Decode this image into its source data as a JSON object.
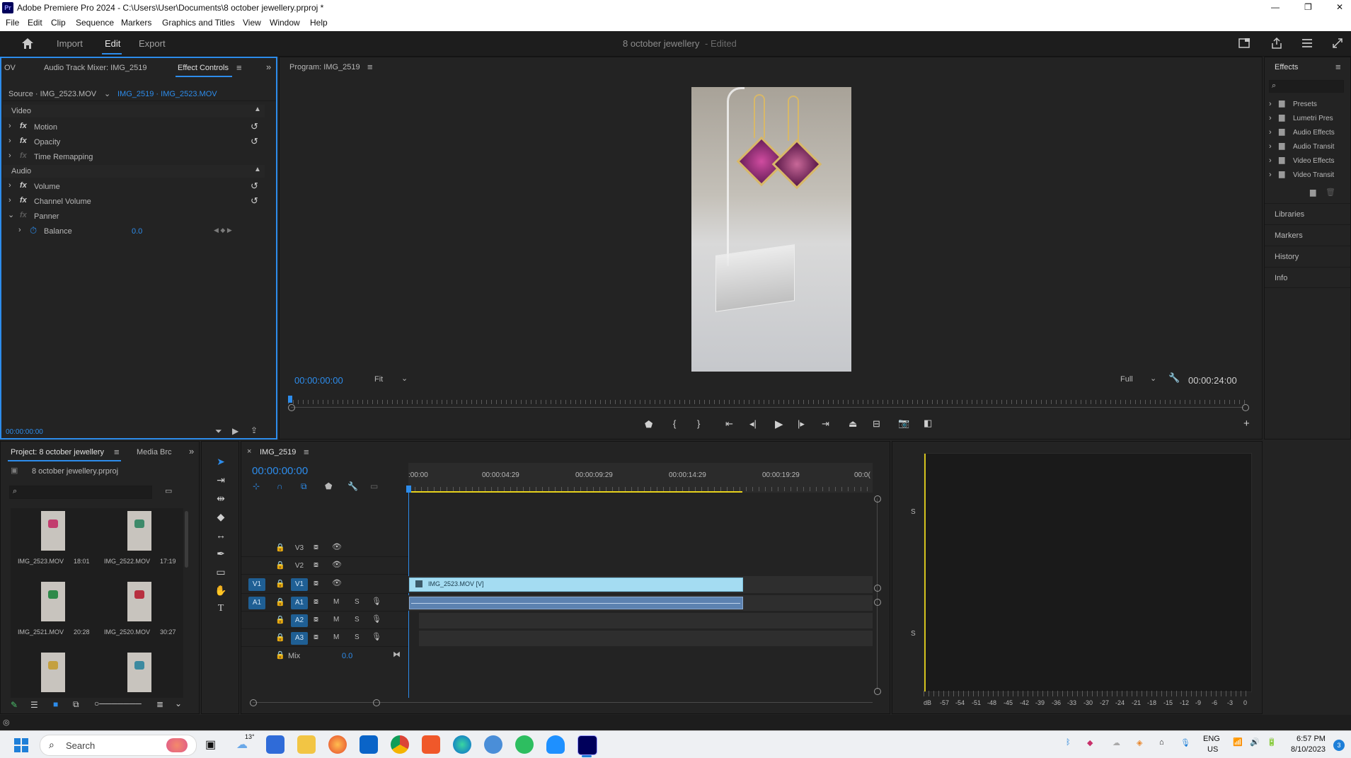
{
  "window": {
    "app_badge": "Pr",
    "title": "Adobe Premiere Pro 2024 - C:\\Users\\User\\Documents\\8 october jewellery.prproj *",
    "min": "—",
    "max": "❐",
    "close": "✕"
  },
  "menu": [
    "File",
    "Edit",
    "Clip",
    "Sequence",
    "Markers",
    "Graphics and Titles",
    "View",
    "Window",
    "Help"
  ],
  "workspace": {
    "tabs": [
      "Import",
      "Edit",
      "Export"
    ],
    "active": "Edit",
    "project_name": "8 october jewellery",
    "status": "- Edited"
  },
  "effect_controls": {
    "tabs": [
      "OV",
      "Audio Track Mixer: IMG_2519",
      "Effect Controls"
    ],
    "source_label": "Source · IMG_2523.MOV",
    "clip_label": "IMG_2519 · IMG_2523.MOV",
    "video_header": "Video",
    "audio_header": "Audio",
    "video_items": [
      "Motion",
      "Opacity",
      "Time Remapping"
    ],
    "audio_items": [
      "Volume",
      "Channel Volume",
      "Panner"
    ],
    "balance_label": "Balance",
    "balance_value": "0.0",
    "timecode": "00:00:00:00"
  },
  "program": {
    "title": "Program: IMG_2519",
    "timecode": "00:00:00:00",
    "fit": "Fit",
    "quality": "Full",
    "duration": "00:00:24:00"
  },
  "effects_panel": {
    "title": "Effects",
    "folders": [
      "Presets",
      "Lumetri Pres",
      "Audio Effects",
      "Audio Transit",
      "Video Effects",
      "Video Transit"
    ],
    "sections": [
      "Libraries",
      "Markers",
      "History",
      "Info"
    ]
  },
  "project": {
    "tabs": [
      "Project: 8 october jewellery",
      "Media Brc"
    ],
    "file": "8 october jewellery.prproj",
    "items": [
      {
        "name": "IMG_2523.MOV",
        "dur": "18:01",
        "color": "#c23d6e"
      },
      {
        "name": "IMG_2522.MOV",
        "dur": "17:19",
        "color": "#3d8a6a"
      },
      {
        "name": "IMG_2521.MOV",
        "dur": "20:28",
        "color": "#2f8a4a"
      },
      {
        "name": "IMG_2520.MOV",
        "dur": "30:27",
        "color": "#b83040"
      },
      {
        "name": "",
        "dur": "",
        "color": "#c4a040"
      },
      {
        "name": "",
        "dur": "",
        "color": "#3c8aa0"
      }
    ]
  },
  "timeline": {
    "tab": "IMG_2519",
    "timecode": "00:00:00:00",
    "ruler": [
      ":00:00",
      "00:00:04:29",
      "00:00:09:29",
      "00:00:14:29",
      "00:00:19:29",
      "00:0("
    ],
    "tracks": [
      {
        "id": "V3",
        "type": "video"
      },
      {
        "id": "V2",
        "type": "video"
      },
      {
        "id": "V1",
        "type": "video",
        "source": "V1"
      },
      {
        "id": "A1",
        "type": "audio",
        "source": "A1",
        "m": "M",
        "s": "S"
      },
      {
        "id": "A2",
        "type": "audio",
        "m": "M",
        "s": "S"
      },
      {
        "id": "A3",
        "type": "audio",
        "m": "M",
        "s": "S"
      }
    ],
    "mix_label": "Mix",
    "mix_value": "0.0",
    "video_clip": "IMG_2523.MOV [V]",
    "clip_end_fraction": 0.72
  },
  "meter": {
    "s_labels": [
      "S",
      "S"
    ],
    "scale": [
      "dB",
      "-57",
      "-54",
      "-51",
      "-48",
      "-45",
      "-42",
      "-39",
      "-36",
      "-33",
      "-30",
      "-27",
      "-24",
      "-21",
      "-18",
      "-15",
      "-12",
      "-9",
      "-6",
      "-3",
      "0"
    ]
  },
  "taskbar": {
    "search": "Search",
    "temp": "13°",
    "lang1": "ENG",
    "lang2": "US",
    "time": "6:57 PM",
    "date": "8/10/2023",
    "notif": "3"
  }
}
